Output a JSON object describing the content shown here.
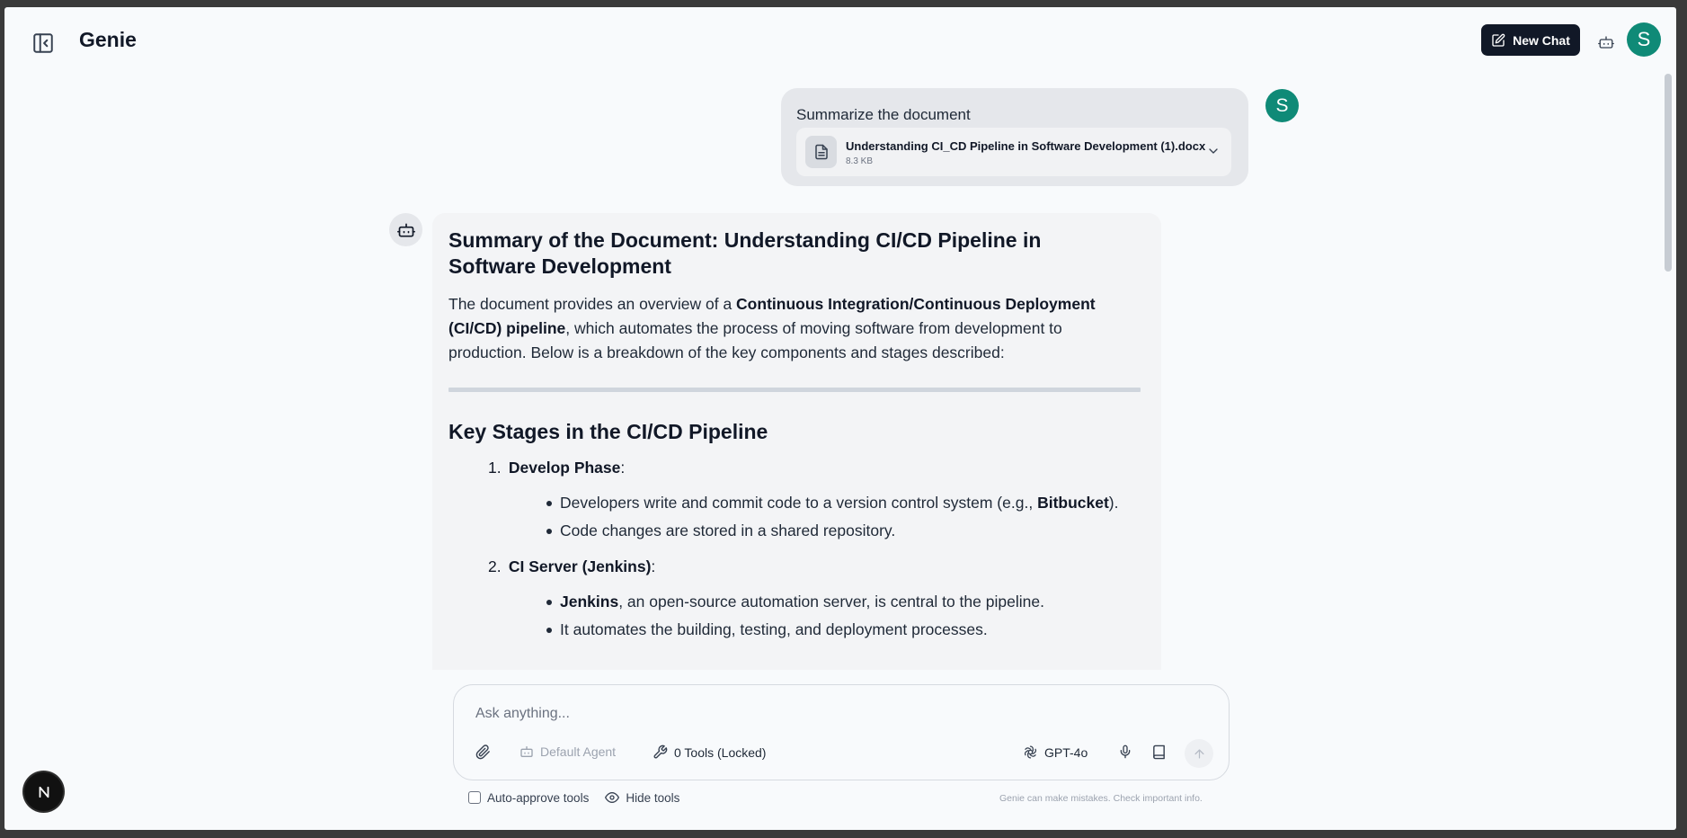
{
  "header": {
    "app_title": "Genie",
    "new_chat_label": "New Chat",
    "user_initial": "S"
  },
  "conversation": {
    "user_message": {
      "text": "Summarize the document",
      "attachment": {
        "name": "Understanding CI_CD Pipeline in Software Development (1).docx",
        "size": "8.3 KB"
      },
      "avatar_initial": "S"
    },
    "assistant_message": {
      "title": "Summary of the Document: Understanding CI/CD Pipeline in Software Development",
      "intro_start": "The document provides an overview of a ",
      "intro_bold": "Continuous Integration/Continuous Deployment (CI/CD) pipeline",
      "intro_end": ", which automates the process of moving software from development to production. Below is a breakdown of the key components and stages described:",
      "section_title": "Key Stages in the CI/CD Pipeline",
      "stages": [
        {
          "number": "1.",
          "title": "Develop Phase",
          "suffix": ":",
          "bullets": [
            {
              "pre": "Developers write and commit code to a version control system (e.g., ",
              "bold": "Bitbucket",
              "post": ")."
            },
            {
              "pre": "Code changes are stored in a shared repository.",
              "bold": "",
              "post": ""
            }
          ]
        },
        {
          "number": "2.",
          "title": "CI Server (Jenkins)",
          "suffix": ":",
          "bullets": [
            {
              "pre": "",
              "bold": "Jenkins",
              "post": ", an open-source automation server, is central to the pipeline."
            },
            {
              "pre": "It automates the building, testing, and deployment processes.",
              "bold": "",
              "post": ""
            }
          ]
        }
      ]
    }
  },
  "composer": {
    "placeholder": "Ask anything...",
    "agent_label": "Default Agent",
    "tools_label": "0 Tools (Locked)",
    "model_label": "GPT-4o"
  },
  "footer": {
    "auto_approve_label": "Auto-approve tools",
    "hide_tools_label": "Hide tools",
    "disclaimer": "Genie can make mistakes. Check important info."
  },
  "badge": {
    "letter": "N"
  },
  "colors": {
    "accent_dark": "#111827",
    "avatar_teal": "#0f8a77",
    "page_bg": "#f8fafc",
    "bubble_bg": "#e5e7eb"
  }
}
